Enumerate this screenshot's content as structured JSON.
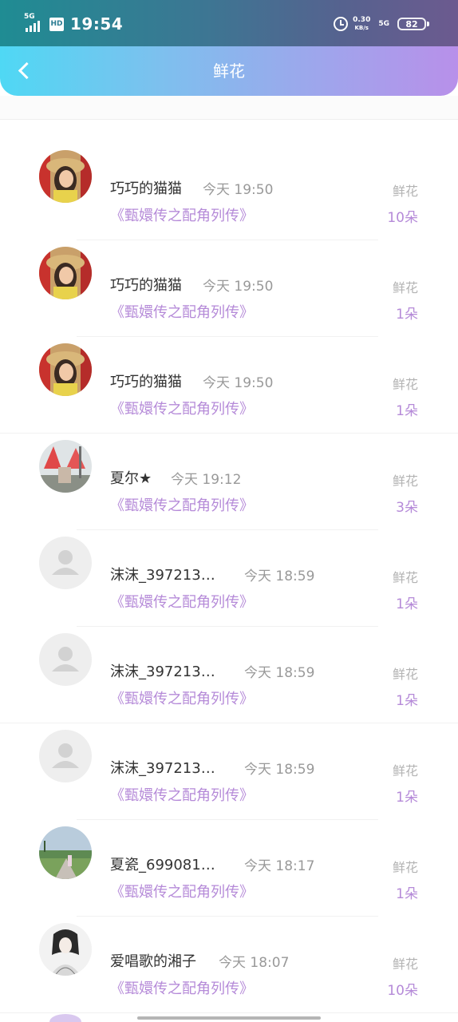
{
  "status_bar": {
    "network_label": "5G",
    "hd_label": "HD",
    "time": "19:54",
    "speed_value": "0.30",
    "speed_unit": "KB/s",
    "network_label_right": "5G",
    "battery_level": "82"
  },
  "nav": {
    "title": "鲜花"
  },
  "list": {
    "items": [
      {
        "name": "巧巧的猫猫",
        "time": "今天 19:50",
        "book": "《甄嬛传之配角列传》",
        "gift_label": "鲜花",
        "count": "10朵",
        "avatar": "photo-woman-hat"
      },
      {
        "name": "巧巧的猫猫",
        "time": "今天 19:50",
        "book": "《甄嬛传之配角列传》",
        "gift_label": "鲜花",
        "count": "1朵",
        "avatar": "photo-woman-hat"
      },
      {
        "name": "巧巧的猫猫",
        "time": "今天 19:50",
        "book": "《甄嬛传之配角列传》",
        "gift_label": "鲜花",
        "count": "1朵",
        "avatar": "photo-woman-hat"
      },
      {
        "name": "夏尔★",
        "time": "今天 19:12",
        "book": "《甄嬛传之配角列传》",
        "gift_label": "鲜花",
        "count": "3朵",
        "avatar": "photo-red-umbrellas"
      },
      {
        "name": "沫沫_397213…",
        "time": "今天 18:59",
        "book": "《甄嬛传之配角列传》",
        "gift_label": "鲜花",
        "count": "1朵",
        "avatar": "default-user"
      },
      {
        "name": "沫沫_397213…",
        "time": "今天 18:59",
        "book": "《甄嬛传之配角列传》",
        "gift_label": "鲜花",
        "count": "1朵",
        "avatar": "default-user"
      },
      {
        "name": "沫沫_397213…",
        "time": "今天 18:59",
        "book": "《甄嬛传之配角列传》",
        "gift_label": "鲜花",
        "count": "1朵",
        "avatar": "default-user"
      },
      {
        "name": "夏瓷_699081…",
        "time": "今天 18:17",
        "book": "《甄嬛传之配角列传》",
        "gift_label": "鲜花",
        "count": "1朵",
        "avatar": "photo-field-sky"
      },
      {
        "name": "爱唱歌的湘子",
        "time": "今天 18:07",
        "book": "《甄嬛传之配角列传》",
        "gift_label": "鲜花",
        "count": "10朵",
        "avatar": "photo-ink-portrait"
      }
    ]
  },
  "colors": {
    "accent_purple": "#b58ad8",
    "header_gradient_start": "#4fd8f4",
    "header_gradient_end": "#b890ea"
  }
}
